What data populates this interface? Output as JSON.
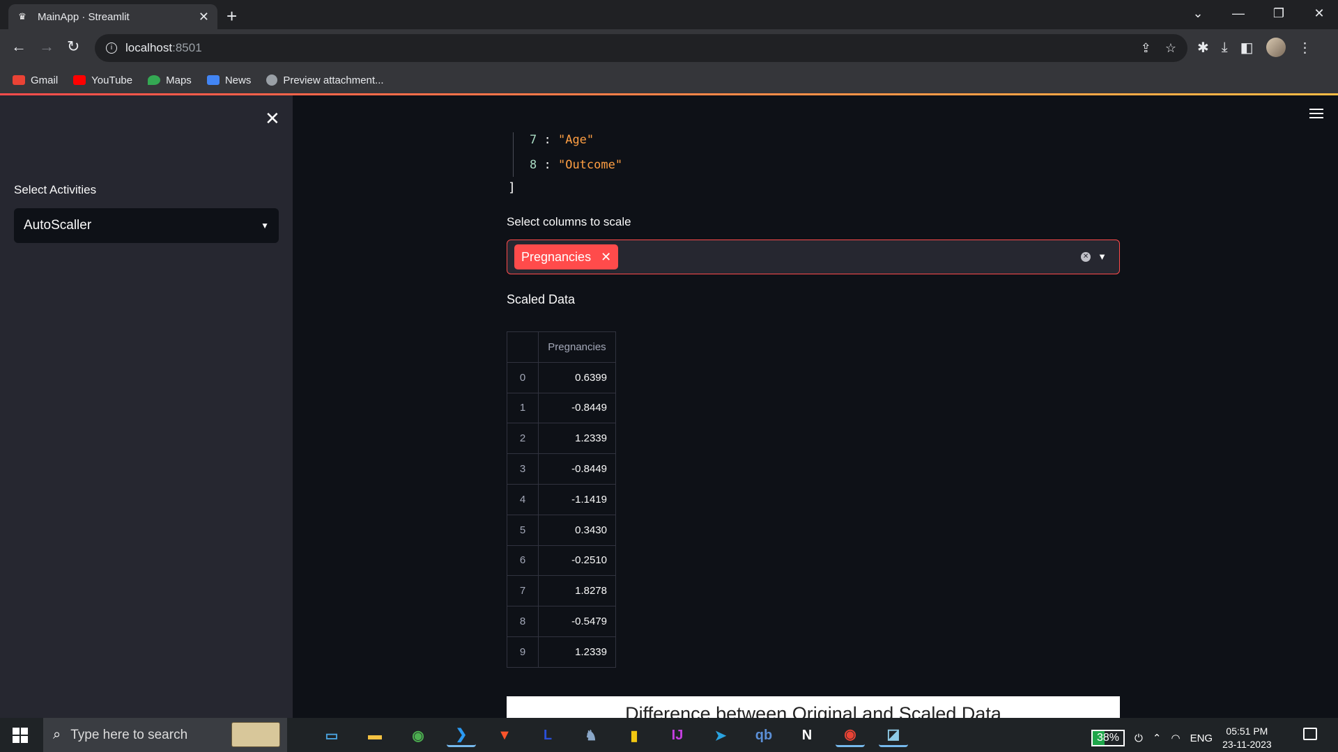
{
  "browser": {
    "tab_title": "MainApp · Streamlit",
    "url_host": "localhost",
    "url_port": ":8501",
    "bookmarks": [
      {
        "label": "Gmail",
        "icon": "gmail-icon",
        "color": "#ea4335"
      },
      {
        "label": "YouTube",
        "icon": "youtube-icon",
        "color": "#ff0000"
      },
      {
        "label": "Maps",
        "icon": "maps-icon",
        "color": "#34a853"
      },
      {
        "label": "News",
        "icon": "news-icon",
        "color": "#4285f4"
      },
      {
        "label": "Preview attachment...",
        "icon": "globe-icon",
        "color": "#9aa0a6"
      }
    ]
  },
  "sidebar": {
    "select_label": "Select Activities",
    "selected_activity": "AutoScaller"
  },
  "json_view": {
    "lines": [
      {
        "index": "7",
        "value": "\"Age\""
      },
      {
        "index": "8",
        "value": "\"Outcome\""
      }
    ],
    "closing": "]"
  },
  "multiselect": {
    "label": "Select columns to scale",
    "chips": [
      "Pregnancies"
    ]
  },
  "scaled": {
    "label": "Scaled Data",
    "column": "Pregnancies",
    "rows": [
      {
        "index": "0",
        "value": "0.6399"
      },
      {
        "index": "1",
        "value": "-0.8449"
      },
      {
        "index": "2",
        "value": "1.2339"
      },
      {
        "index": "3",
        "value": "-0.8449"
      },
      {
        "index": "4",
        "value": "-1.1419"
      },
      {
        "index": "5",
        "value": "0.3430"
      },
      {
        "index": "6",
        "value": "-0.2510"
      },
      {
        "index": "7",
        "value": "1.8278"
      },
      {
        "index": "8",
        "value": "-0.5479"
      },
      {
        "index": "9",
        "value": "1.2339"
      }
    ]
  },
  "plot": {
    "title": "Difference between Original and Scaled Data"
  },
  "taskbar": {
    "search_placeholder": "Type here to search",
    "battery": "38%",
    "language": "ENG",
    "time": "05:51 PM",
    "date": "23-11-2023",
    "apps": [
      {
        "name": "desktop-icon",
        "glyph": "▭",
        "color": "#4aa3df",
        "active": false
      },
      {
        "name": "file-explorer-icon",
        "glyph": "▬",
        "color": "#f4c242",
        "active": false
      },
      {
        "name": "chrome-icon",
        "glyph": "◉",
        "color": "#4caf50",
        "active": false
      },
      {
        "name": "vscode-icon",
        "glyph": "❯",
        "color": "#2b9af3",
        "active": true
      },
      {
        "name": "brave-icon",
        "glyph": "▼",
        "color": "#fb542b",
        "active": false
      },
      {
        "name": "lively-icon",
        "glyph": "L",
        "color": "#2a4fd8",
        "active": false
      },
      {
        "name": "postgres-icon",
        "glyph": "♞",
        "color": "#8aa7c8",
        "active": false
      },
      {
        "name": "powerbi-icon",
        "glyph": "▮",
        "color": "#f2c811",
        "active": false
      },
      {
        "name": "intellij-icon",
        "glyph": "IJ",
        "color": "#c43fe0",
        "active": false
      },
      {
        "name": "telegram-icon",
        "glyph": "➤",
        "color": "#2aa3e0",
        "active": false
      },
      {
        "name": "qbittorrent-icon",
        "glyph": "qb",
        "color": "#5b8fd6",
        "active": false
      },
      {
        "name": "notion-icon",
        "glyph": "N",
        "color": "#ffffff",
        "active": false
      },
      {
        "name": "chrome-active-icon",
        "glyph": "◉",
        "color": "#ea4335",
        "active": true
      },
      {
        "name": "notepad-icon",
        "glyph": "◪",
        "color": "#8ecae6",
        "active": true
      }
    ]
  }
}
